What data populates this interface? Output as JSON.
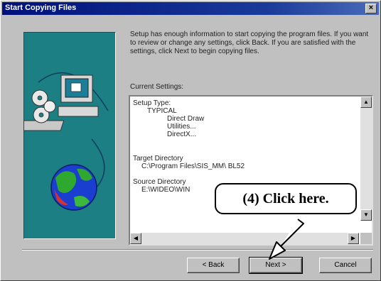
{
  "window": {
    "title": "Start Copying Files",
    "close_label": "×"
  },
  "description": "Setup has enough information to start copying the program files. If you want to review or change any settings, click Back. If you are satisfied with the settings, click Next to begin copying files.",
  "current_settings": {
    "label": "Current Settings:",
    "lines": [
      "Setup Type:",
      "TYPICAL",
      "Direct Draw",
      "Utilities...",
      "DirectX...",
      "Target Directory",
      "C:\\Program Files\\SIS_MM\\ BL52",
      "Source Directory",
      "E:\\WIDEO\\WIN"
    ]
  },
  "buttons": {
    "back": "< Back",
    "next": "Next >",
    "cancel": "Cancel"
  },
  "callout": {
    "text": "(4)  Click here."
  },
  "icons": {
    "computer": "computer-icon",
    "disks": "disks-icon",
    "globe": "globe-icon"
  },
  "colors": {
    "title_bar": "#00107a",
    "illustration_bg": "#1b7f84",
    "dialog_bg": "#c0c0c0"
  }
}
